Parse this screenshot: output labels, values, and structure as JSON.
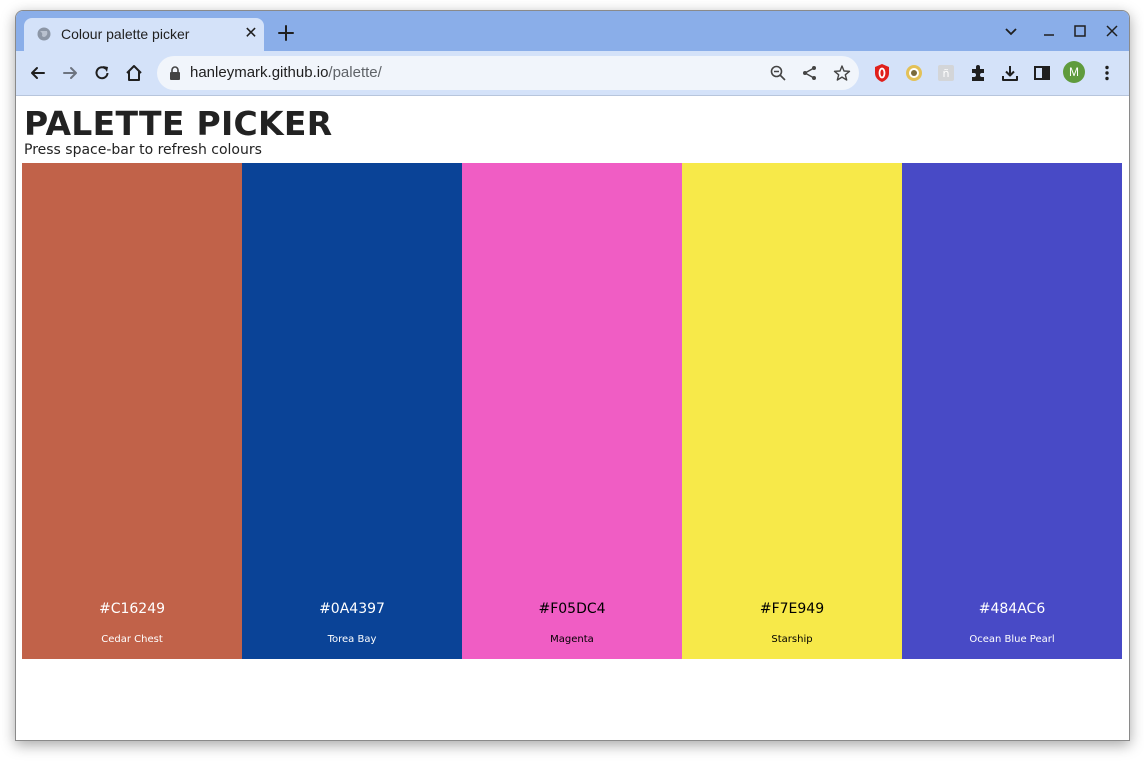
{
  "browser": {
    "tab_title": "Colour palette picker",
    "url_host": "hanleymark.github.io",
    "url_path": "/palette/",
    "avatar_initial": "M"
  },
  "page": {
    "title": "PALETTE PICKER",
    "subtitle": "Press space-bar to refresh colours"
  },
  "swatches": [
    {
      "hex": "#C16249",
      "name": "Cedar Chest",
      "color": "#C16249",
      "text_color": "#ffffff"
    },
    {
      "hex": "#0A4397",
      "name": "Torea Bay",
      "color": "#0A4397",
      "text_color": "#ffffff"
    },
    {
      "hex": "#F05DC4",
      "name": "Magenta",
      "color": "#F05DC4",
      "text_color": "#000000"
    },
    {
      "hex": "#F7E949",
      "name": "Starship",
      "color": "#F7E949",
      "text_color": "#000000"
    },
    {
      "hex": "#484AC6",
      "name": "Ocean Blue Pearl",
      "color": "#484AC6",
      "text_color": "#ffffff"
    }
  ],
  "colors": {
    "tabbar": "#8aaee9",
    "toolbar": "#d4e2f9",
    "omnibox": "#f1f5fb"
  },
  "icons": [
    "globe-icon",
    "close-icon",
    "plus-icon",
    "chevron-down-icon",
    "minimize-icon",
    "maximize-icon",
    "back-icon",
    "forward-icon",
    "reload-icon",
    "home-icon",
    "lock-icon",
    "zoom-icon",
    "share-icon",
    "star-icon",
    "extension-opera-icon",
    "extension-coin-icon",
    "extension-translate-icon",
    "puzzle-icon",
    "download-icon",
    "sidepanel-icon",
    "kebab-menu-icon"
  ]
}
